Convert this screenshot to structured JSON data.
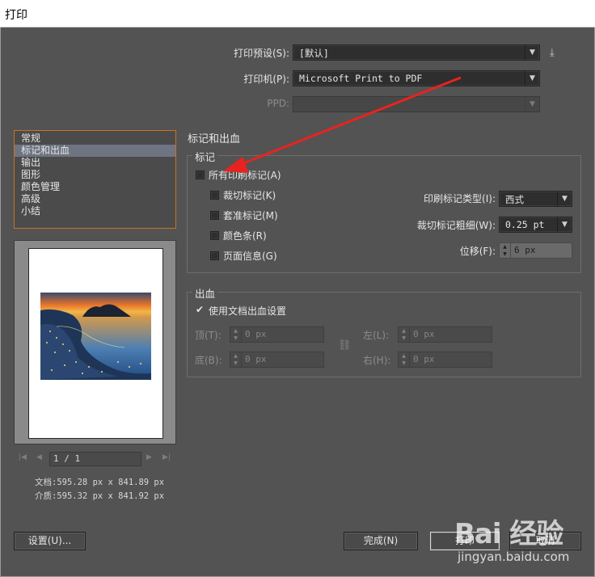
{
  "window": {
    "title": "打印"
  },
  "header": {
    "preset_label": "打印预设(S):",
    "preset_value": "[默认]",
    "printer_label": "打印机(P):",
    "printer_value": "Microsoft Print to PDF",
    "ppd_label": "PPD:",
    "ppd_value": "",
    "export_icon": "export-icon"
  },
  "sidebar": {
    "items": [
      {
        "label": "常规"
      },
      {
        "label": "标记和出血"
      },
      {
        "label": "输出"
      },
      {
        "label": "图形"
      },
      {
        "label": "颜色管理"
      },
      {
        "label": "高级"
      },
      {
        "label": "小结"
      }
    ],
    "selected_index": 1,
    "accent_color": "#c8741f"
  },
  "preview": {
    "page_indicator": "1 / 1",
    "document_size": "文档:595.28 px x 841.89 px",
    "media_size": "介质:595.32 px x 841.92 px"
  },
  "main": {
    "section_title": "标记和出血",
    "marks": {
      "group_title": "标记",
      "all_marks_label": "所有印刷标记(A)",
      "all_marks_checked": false,
      "options": [
        {
          "label": "裁切标记(K)",
          "checked": false
        },
        {
          "label": "套准标记(M)",
          "checked": false
        },
        {
          "label": "颜色条(R)",
          "checked": false
        },
        {
          "label": "页面信息(G)",
          "checked": false
        }
      ],
      "mark_type_label": "印刷标记类型(I):",
      "mark_type_value": "西式",
      "weight_label": "裁切标记粗细(W):",
      "weight_value": "0.25 pt",
      "offset_label": "位移(F):",
      "offset_value": "6 px"
    },
    "bleed": {
      "group_title": "出血",
      "use_doc_label": "使用文档出血设置",
      "use_doc_checked": true,
      "top_label": "顶(T):",
      "top_value": "0 px",
      "bottom_label": "底(B):",
      "bottom_value": "0 px",
      "left_label": "左(L):",
      "left_value": "0 px",
      "right_label": "右(H):",
      "right_value": "0 px",
      "link_icon": "chain-link-icon"
    }
  },
  "footer": {
    "setup_label": "设置(U)...",
    "done_label": "完成(N)",
    "print_label": "打印",
    "cancel_label": "取消"
  },
  "watermark": {
    "logo": "Bai 经验",
    "url": "jingyan.baidu.com"
  }
}
